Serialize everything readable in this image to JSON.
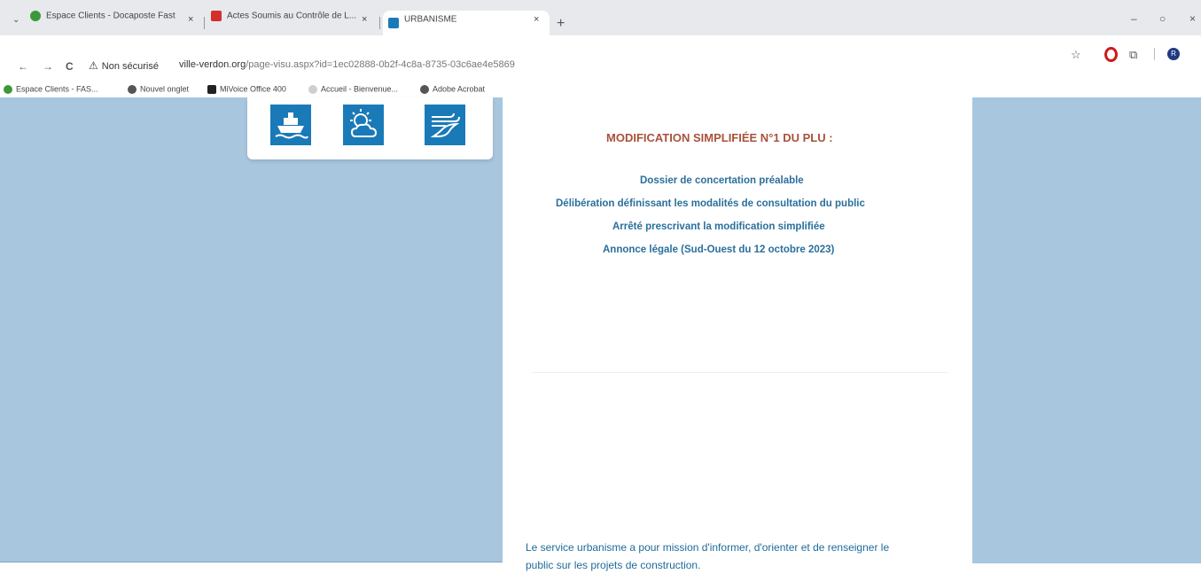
{
  "browser": {
    "tabs": [
      {
        "title": "Espace Clients - Docaposte Fast",
        "active": false,
        "favicon_color": "#3a9a3a"
      },
      {
        "title": "Actes Soumis au Contrôle de L...",
        "active": false,
        "favicon_color": "#d32f2f"
      },
      {
        "title": "URBANISME",
        "active": true,
        "favicon_color": "#1a7ab8"
      }
    ],
    "tab_close": "×",
    "new_tab": "+",
    "window_controls": {
      "minimize": "–",
      "restore": "○",
      "close": "×"
    },
    "nav": {
      "back": "←",
      "forward": "→",
      "reload": "C"
    },
    "security_label": "Non sécurisé",
    "url_host": "ville-verdon.org",
    "url_path": "/page-visu.aspx?id=1ec02888-0b2f-4c8a-8735-03c6ae4e5869",
    "profile_initial": "R",
    "bookmarks": [
      {
        "label": "Espace Clients - FAS...",
        "icon_color": "#3a9a3a"
      },
      {
        "label": "Nouvel onglet",
        "icon_color": "#555555"
      },
      {
        "label": "MiVoice Office 400",
        "icon_color": "#222222"
      },
      {
        "label": "Accueil - Bienvenue...",
        "icon_color": "#cfcfcf"
      },
      {
        "label": "Adobe Acrobat",
        "icon_color": "#555555"
      }
    ]
  },
  "icons": [
    {
      "name": "ship-icon"
    },
    {
      "name": "sun-cloud-icon"
    },
    {
      "name": "wind-wave-icon"
    }
  ],
  "content": {
    "title": "MODIFICATION SIMPLIFIÉE N°1 DU PLU :",
    "links": [
      "Dossier de concertation préalable",
      "Délibération définissant les modalités de consultation du public",
      "Arrêté prescrivant la modification simplifiée",
      "Annonce légale (Sud-Ouest du 12 octobre 2023)"
    ],
    "footer_line1": "Le service urbanisme a pour mission d'informer, d'orienter et de renseigner le",
    "footer_line2": "public  sur les projets de construction."
  },
  "colors": {
    "accent_blue": "#1a7ab8",
    "title_red": "#a9523a",
    "link_blue": "#2a6f9c",
    "side_panel": "#a8c6de"
  }
}
